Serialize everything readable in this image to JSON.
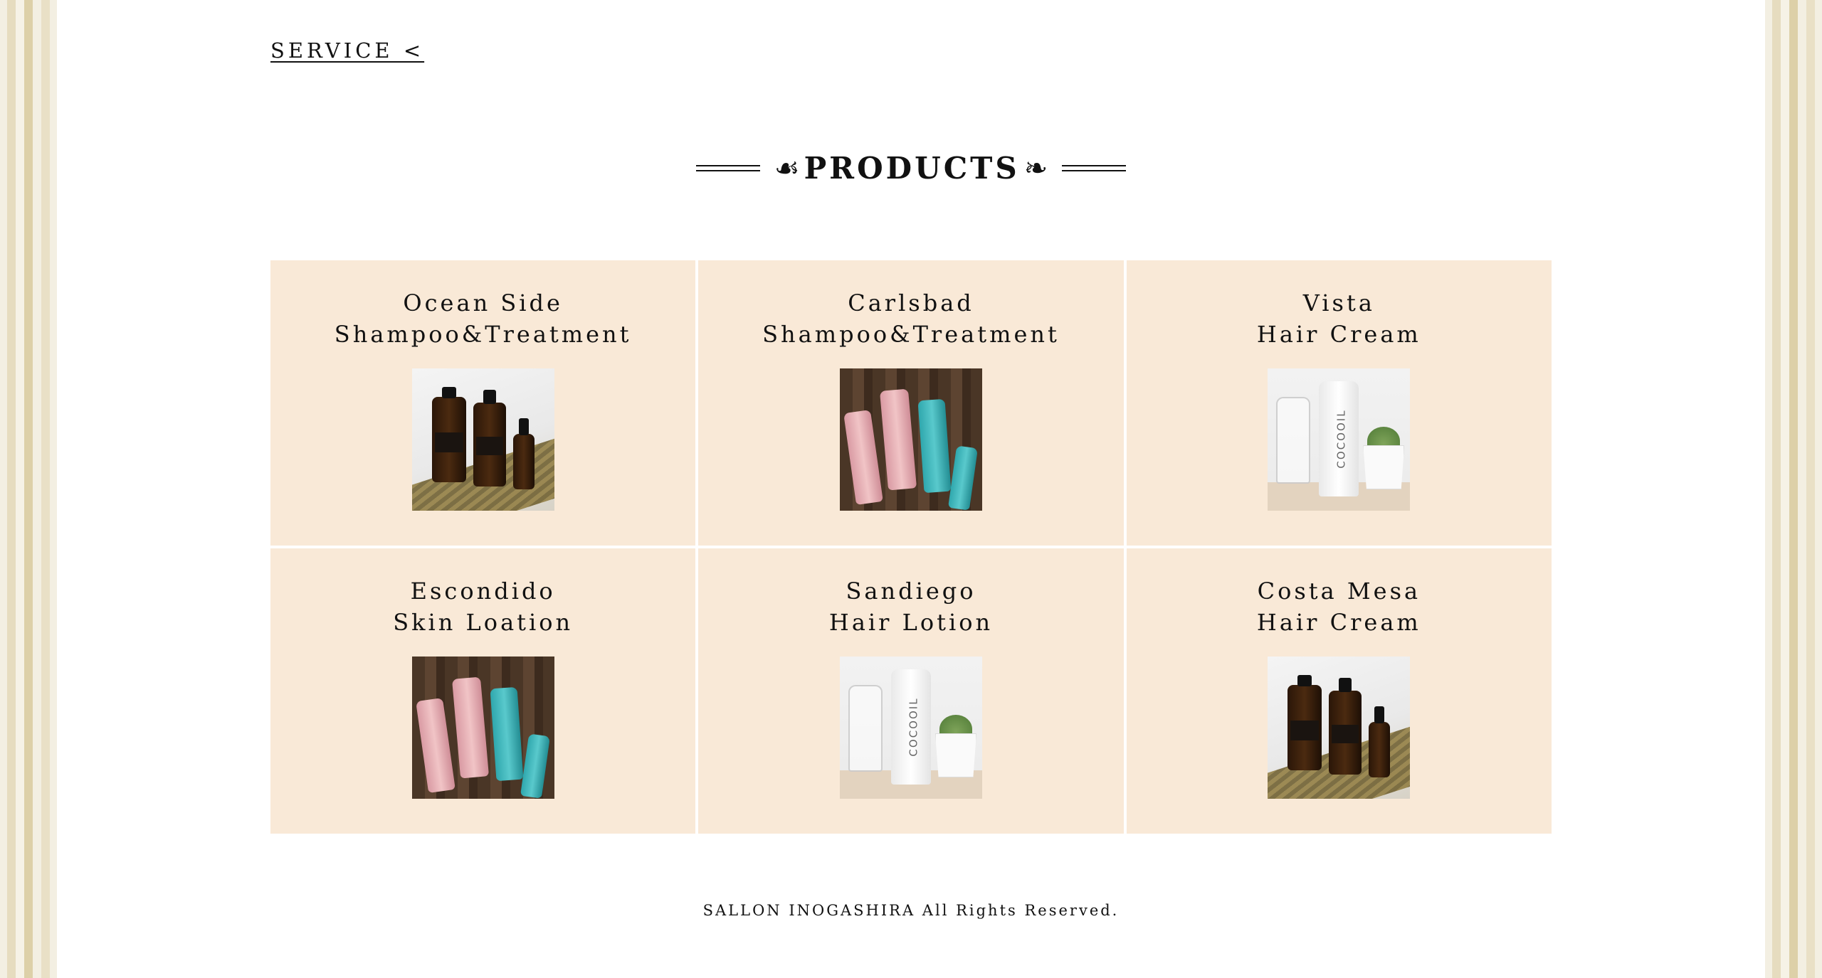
{
  "nav": {
    "service_link": "SERVICE <"
  },
  "products_section": {
    "title": "PRODUCTS",
    "left_ornament": "☙",
    "right_ornament": "❧"
  },
  "products": [
    {
      "line1": "Ocean Side",
      "line2": "Shampoo&Treatment",
      "image": "amber-bottles"
    },
    {
      "line1": "Carlsbad",
      "line2": "Shampoo&Treatment",
      "image": "pink-teal-bottles"
    },
    {
      "line1": "Vista",
      "line2": "Hair Cream",
      "image": "white-cocooil-bottle",
      "brand_text": "COCOOIL"
    },
    {
      "line1": "Escondido",
      "line2": "Skin Loation",
      "image": "pink-teal-bottles"
    },
    {
      "line1": "Sandiego",
      "line2": "Hair Lotion",
      "image": "white-cocooil-bottle",
      "brand_text": "COCOOIL"
    },
    {
      "line1": "Costa Mesa",
      "line2": "Hair Cream",
      "image": "amber-bottles"
    }
  ],
  "colors": {
    "card_bg": "#f9e9d7",
    "text": "#111111",
    "page_bg": "#ffffff"
  },
  "footer": {
    "copyright": "SALLON INOGASHIRA All Rights Reserved."
  }
}
